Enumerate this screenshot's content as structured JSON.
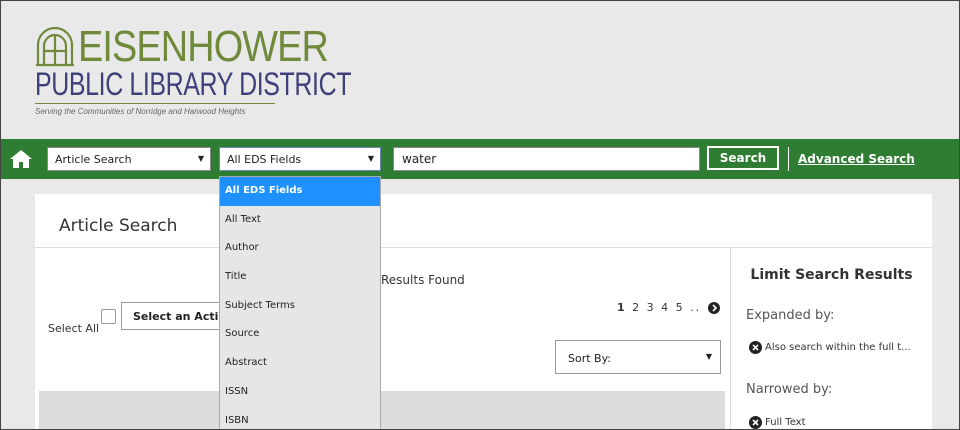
{
  "brand": {
    "name_line1": "EISENHOWER",
    "name_line2": "PUBLIC LIBRARY DISTRICT",
    "tagline": "Serving the Communities of Norridge and Harwood Heights",
    "colors": {
      "olive": "#6f8a3a",
      "navy": "#3f3f7a",
      "bar_green": "#2e7d32",
      "highlight_blue": "#1e90ff"
    }
  },
  "search_bar": {
    "home_icon": "home-icon",
    "search_type": "Article Search",
    "field": "All EDS Fields",
    "query": "water",
    "search_label": "Search",
    "advanced_label": "Advanced Search"
  },
  "field_dropdown": {
    "options": [
      "All EDS Fields",
      "All Text",
      "Author",
      "Title",
      "Subject Terms",
      "Source",
      "Abstract",
      "ISSN",
      "ISBN"
    ],
    "selected": "All EDS Fields"
  },
  "main": {
    "title": "Article Search",
    "results_text": "Results Found",
    "select_all_label": "Select All",
    "action_label": "Select an Action",
    "pages": [
      "1",
      "2",
      "3",
      "4",
      "5",
      ".."
    ],
    "sort_label": "Sort By:"
  },
  "sidebar": {
    "title": "Limit Search Results",
    "expanded_label": "Expanded by:",
    "expanded_item": "Also search within the full t...",
    "narrowed_label": "Narrowed by:",
    "narrowed_item": "Full Text"
  }
}
